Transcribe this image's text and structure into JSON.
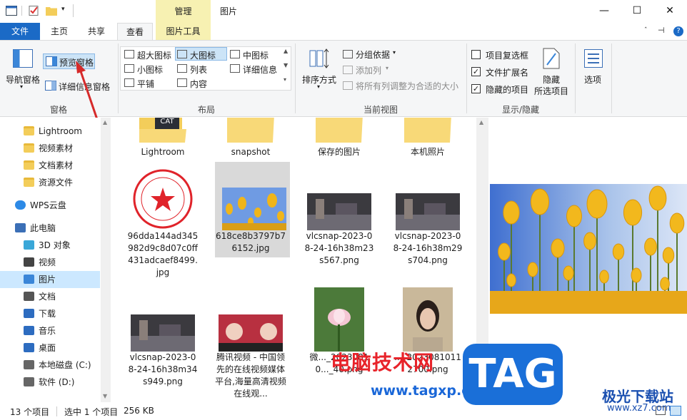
{
  "window": {
    "title": "图片",
    "context_tab_group": "管理",
    "controls": {
      "minimize": "—",
      "maximize": "☐",
      "close": "✕"
    }
  },
  "ribbon_tabs": [
    "文件",
    "主页",
    "共享",
    "查看",
    "图片工具"
  ],
  "ribbon_right": {
    "pin": "⊣",
    "help": "?"
  },
  "ribbon": {
    "pane_group": {
      "label": "窗格",
      "nav_pane": "导航窗格",
      "preview_pane": "预览窗格",
      "details_pane": "详细信息窗格"
    },
    "layout_group": {
      "label": "布局",
      "items": [
        "超大图标",
        "大图标",
        "中图标",
        "小图标",
        "列表",
        "详细信息",
        "平铺",
        "内容"
      ],
      "selected": "大图标"
    },
    "current_view_group": {
      "label": "当前视图",
      "sort_by": "排序方式",
      "group_by": "分组依据",
      "add_columns": "添加列",
      "size_columns": "将所有列调整为合适的大小"
    },
    "show_hide_group": {
      "label": "显示/隐藏",
      "item_checkboxes": {
        "label": "项目复选框",
        "checked": false
      },
      "file_extensions": {
        "label": "文件扩展名",
        "checked": true
      },
      "hidden_items": {
        "label": "隐藏的项目",
        "checked": true
      },
      "hide_selected_1": "隐藏",
      "hide_selected_2": "所选项目"
    },
    "options": "选项"
  },
  "nav": {
    "items": [
      {
        "label": "Lightroom",
        "icon": "folder-icon"
      },
      {
        "label": "视频素材",
        "icon": "folder-icon"
      },
      {
        "label": "文档素材",
        "icon": "folder-icon"
      },
      {
        "label": "资源文件",
        "icon": "folder-icon"
      },
      {
        "label": "WPS云盘",
        "icon": "cloud-icon"
      },
      {
        "label": "此电脑",
        "icon": "pc-icon"
      },
      {
        "label": "3D 对象",
        "icon": "3d-icon"
      },
      {
        "label": "视频",
        "icon": "video-icon"
      },
      {
        "label": "图片",
        "icon": "picture-icon"
      },
      {
        "label": "文档",
        "icon": "document-icon"
      },
      {
        "label": "下载",
        "icon": "download-icon"
      },
      {
        "label": "音乐",
        "icon": "music-icon"
      },
      {
        "label": "桌面",
        "icon": "desktop-icon"
      },
      {
        "label": "本地磁盘 (C:)",
        "icon": "drive-icon"
      },
      {
        "label": "软件 (D:)",
        "icon": "drive-icon"
      }
    ],
    "selected": "图片"
  },
  "files": [
    {
      "name": "Lightroom",
      "type": "folder"
    },
    {
      "name": "snapshot",
      "type": "folder"
    },
    {
      "name": "保存的图片",
      "type": "folder"
    },
    {
      "name": "本机照片",
      "type": "folder"
    },
    {
      "name": "96dda144ad345982d9c8d07c0ff431adcaef8499.jpg",
      "type": "seal"
    },
    {
      "name": "618ce8b3797b76152.jpg",
      "type": "tulip",
      "selected": true
    },
    {
      "name": "vlcsnap-2023-08-24-16h38m23s567.png",
      "type": "video"
    },
    {
      "name": "vlcsnap-2023-08-24-16h38m29s704.png",
      "type": "video"
    },
    {
      "name": "vlcsnap-2023-08-24-16h38m34s949.png",
      "type": "video"
    },
    {
      "name": "腾讯视频 - 中国领先的在线视频媒体平台,海量高清视频在线观...",
      "type": "people"
    },
    {
      "name": "微..._20230810..._40.png",
      "type": "lotus"
    },
    {
      "name": "..._20230810112700.png",
      "type": "portrait"
    }
  ],
  "folder_badge": "CAT",
  "status": {
    "count": "13 个项目",
    "selected": "选中 1 个项目",
    "size": "256 KB"
  },
  "watermarks": {
    "site_cn": "电脑技术网",
    "site_url": "www.tagxp.com",
    "tag": "TAG",
    "jg_cn": "极光下载站",
    "jg_url": "www.xz7.com"
  }
}
